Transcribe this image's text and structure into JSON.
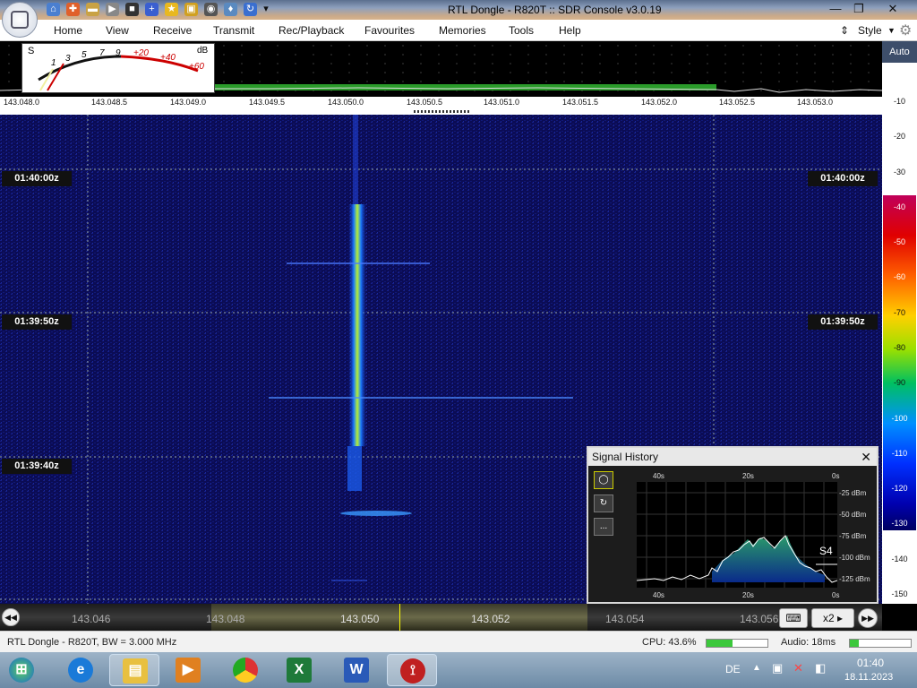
{
  "window": {
    "title": "RTL Dongle - R820T :: SDR Console v3.0.19"
  },
  "menu": {
    "items": [
      "Home",
      "View",
      "Receive",
      "Transmit",
      "Rec/Playback",
      "Favourites",
      "Memories",
      "Tools",
      "Help"
    ],
    "style": "Style"
  },
  "meter": {
    "s_label": "S",
    "db_label": "dB",
    "scale": [
      "1",
      "3",
      "5",
      "7",
      "9",
      "+20",
      "+40",
      "+60"
    ]
  },
  "freq_scale": [
    "143.048.0",
    "143.048.5",
    "143.049.0",
    "143.049.5",
    "143.050.0",
    "143.050.5",
    "143.051.0",
    "143.051.5",
    "143.052.0",
    "143.052.5",
    "143.053.0"
  ],
  "db_scale": {
    "auto": "Auto",
    "labels": [
      "-10",
      "-20",
      "-30",
      "-40",
      "-50",
      "-60",
      "-70",
      "-80",
      "-90",
      "-100",
      "-110",
      "-120",
      "-130",
      "-140",
      "-150"
    ]
  },
  "waterfall": {
    "times": [
      "01:40:00z",
      "01:39:50z",
      "01:39:40z"
    ]
  },
  "bottom_freq": [
    "143.046",
    "143.048",
    "143.050",
    "143.052",
    "143.054",
    "143.056"
  ],
  "controls": {
    "zoom": "x2"
  },
  "signal_history": {
    "title": "Signal History",
    "top_axis": [
      "40s",
      "20s",
      "0s"
    ],
    "bottom_axis": [
      "40s",
      "20s",
      "0s"
    ],
    "y_axis": [
      "-25 dBm",
      "-50 dBm",
      "-75 dBm",
      "-100 dBm",
      "-125 dBm"
    ],
    "s_readout": "S4",
    "more": "..."
  },
  "status": {
    "device": "RTL Dongle - R820T, BW = 3.000 MHz",
    "cpu": "CPU: 43.6%",
    "cpu_pct": 0.43,
    "audio": "Audio: 18ms",
    "audio_pct": 0.15
  },
  "tray": {
    "lang": "DE",
    "time": "01:40",
    "date": "18.11.2023"
  }
}
